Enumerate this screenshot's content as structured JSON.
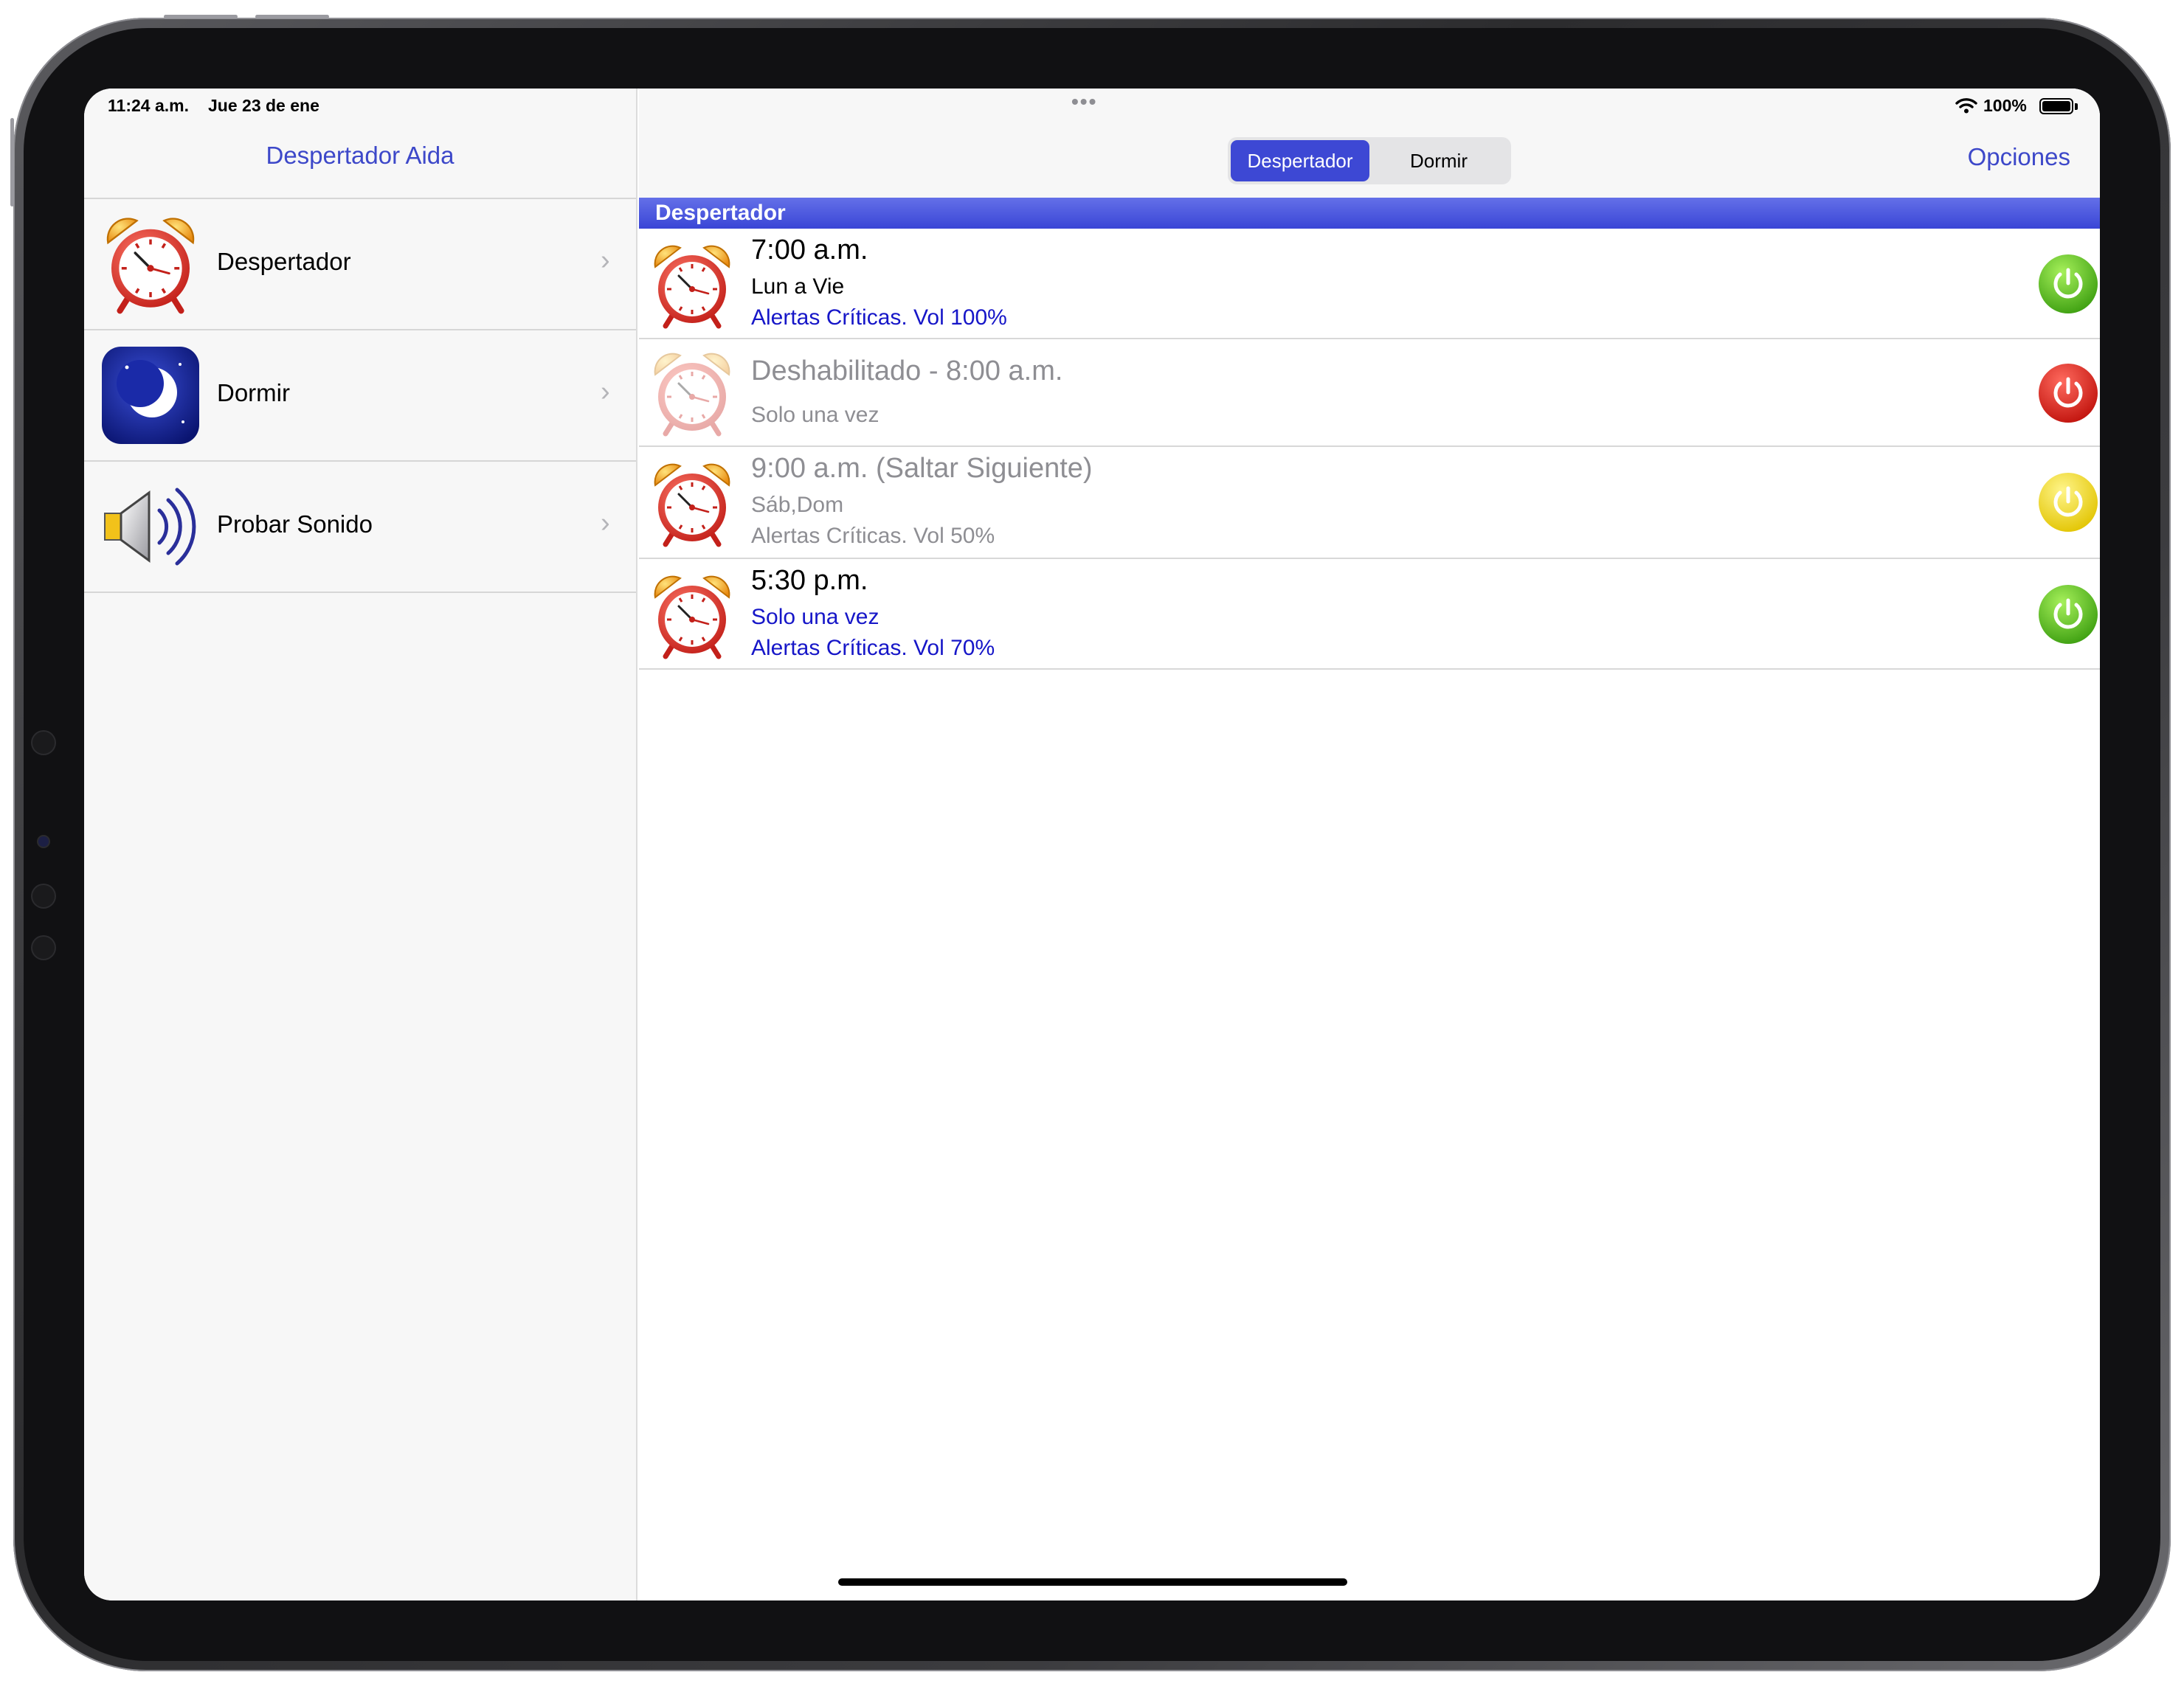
{
  "status_bar": {
    "time": "11:24 a.m.",
    "date": "Jue 23 de ene",
    "multitask_dots": "•••",
    "battery_percent": "100%",
    "icons": [
      "wifi-icon",
      "battery-icon"
    ]
  },
  "sidebar": {
    "title": "Despertador Aida",
    "items": [
      {
        "label": "Despertador",
        "icon": "alarm-clock-icon"
      },
      {
        "label": "Dormir",
        "icon": "moon-icon"
      },
      {
        "label": "Probar Sonido",
        "icon": "speaker-icon"
      }
    ],
    "chevron": "›"
  },
  "nav": {
    "segments": [
      {
        "label": "Despertador",
        "selected": true
      },
      {
        "label": "Dormir",
        "selected": false
      }
    ],
    "options_label": "Opciones"
  },
  "section_header": "Despertador",
  "alarms": [
    {
      "time": "7:00 a.m.",
      "line2": "Lun a Vie",
      "line3": "Alertas Críticas. Vol 100%",
      "state": "enabled",
      "power_color": "green"
    },
    {
      "time": "Deshabilitado - 8:00 a.m.",
      "line2": "Solo una vez",
      "line3": "",
      "state": "disabled",
      "power_color": "red"
    },
    {
      "time": "9:00 a.m. (Saltar Siguiente)",
      "line2": "Sáb,Dom",
      "line3": "Alertas Críticas. Vol 50%",
      "state": "skipped",
      "power_color": "yellow"
    },
    {
      "time": "5:30 p.m.",
      "line2": "Solo una vez",
      "line3": "Alertas Críticas. Vol 70%",
      "state": "enabled",
      "power_color": "green"
    }
  ],
  "colors": {
    "accent": "#3d48c9",
    "segment_active": "#3d48d4",
    "link_blue": "#1616c8",
    "disabled_text": "#8e8e93",
    "power_green": "#5cc21c",
    "power_red": "#e0261e",
    "power_yellow": "#f0d800"
  }
}
